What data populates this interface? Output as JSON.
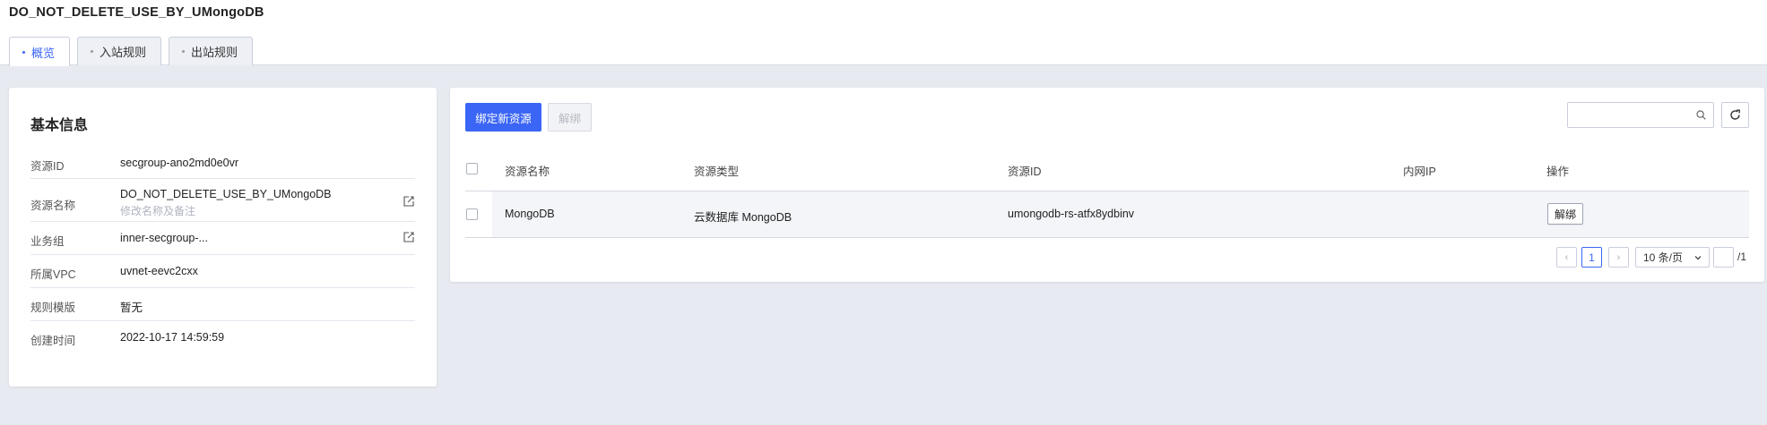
{
  "page": {
    "title": "DO_NOT_DELETE_USE_BY_UMongoDB"
  },
  "tabs": [
    {
      "label": "概览",
      "active": true
    },
    {
      "label": "入站规则",
      "active": false
    },
    {
      "label": "出站规则",
      "active": false
    }
  ],
  "basic_info": {
    "title": "基本信息",
    "rows": [
      {
        "label": "资源ID",
        "value": "secgroup-ano2md0e0vr"
      },
      {
        "label": "资源名称",
        "value": "DO_NOT_DELETE_USE_BY_UMongoDB",
        "sub": "修改名称及备注",
        "editable": true
      },
      {
        "label": "业务组",
        "value": "inner-secgroup-...",
        "editable": true
      },
      {
        "label": "所属VPC",
        "value": "uvnet-eevc2cxx"
      },
      {
        "label": "规则模版",
        "value": "暂无"
      },
      {
        "label": "创建时间",
        "value": "2022-10-17 14:59:59"
      }
    ]
  },
  "toolbar": {
    "bind_label": "绑定新资源",
    "unbind_label": "解绑",
    "search_placeholder": ""
  },
  "table": {
    "headers": [
      "资源名称",
      "资源类型",
      "资源ID",
      "内网IP",
      "操作"
    ],
    "rows": [
      {
        "name": "MongoDB",
        "type": "云数据库 MongoDB",
        "id": "umongodb-rs-atfx8ydbinv",
        "ip": "",
        "action": "解绑"
      }
    ]
  },
  "pagination": {
    "prev": "‹",
    "current": "1",
    "next": "›",
    "page_size": "10 条/页",
    "jump_value": "",
    "total": "/1"
  },
  "colors": {
    "accent": "#3b66f5",
    "background": "#e8eaf1"
  },
  "icons": {
    "edit": "edit-icon",
    "search": "search-icon",
    "refresh": "refresh-icon",
    "chevron": "chevron-down-icon"
  }
}
